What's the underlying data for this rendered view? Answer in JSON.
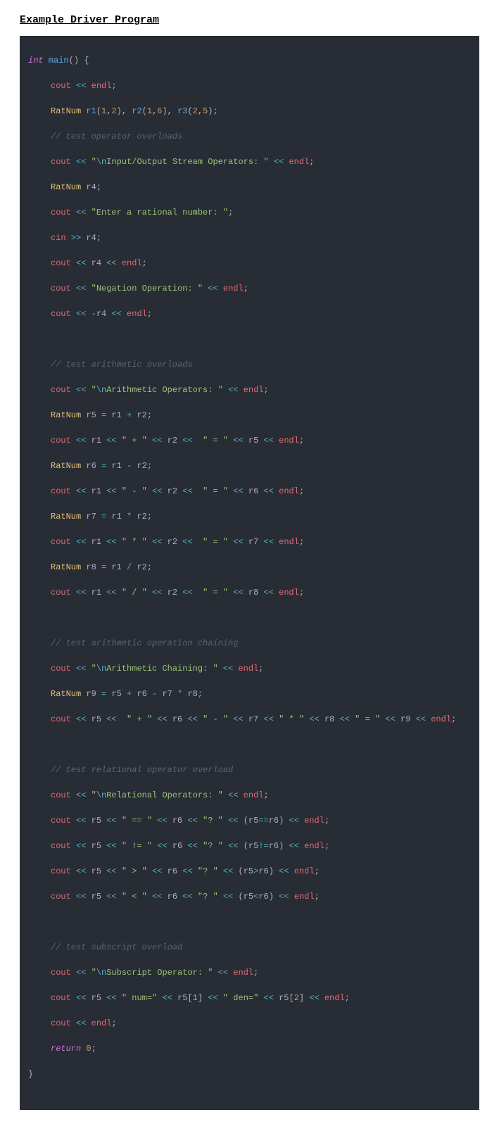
{
  "title": "Example Driver Program",
  "code": {
    "l01": {
      "kw": "int",
      "fn": " main",
      "p1": "() {"
    },
    "l02": {
      "o1": "cout ",
      "op1": "<<",
      "o2": " endl",
      "p": ";"
    },
    "l03": {
      "t": "RatNum ",
      "a": "r1",
      "p1": "(",
      "n1": "1",
      "c1": ",",
      "n2": "2",
      "p2": "), ",
      "b": "r2",
      "p3": "(",
      "n3": "1",
      "c2": ",",
      "n4": "6",
      "p4": "), ",
      "c": "r3",
      "p5": "(",
      "n5": "2",
      "c3": ",",
      "n6": "5",
      "p6": ");"
    },
    "l04": {
      "cmt": "// test operator overloads"
    },
    "l05": {
      "a": "cout ",
      "op1": "<<",
      "sp": " ",
      "s1": "\"",
      "e1": "\\n",
      "s2": "Input/Output Stream Operators: \"",
      "sp2": " ",
      "op2": "<<",
      "b": " endl",
      "p": ";"
    },
    "l06": {
      "t": "RatNum ",
      "v": "r4",
      "p": ";"
    },
    "l07": {
      "a": "cout ",
      "op": "<<",
      "s": " \"Enter a rational number: \"",
      "p": ";"
    },
    "l08": {
      "a": "cin ",
      "op": ">>",
      "b": " r4",
      "p": ";"
    },
    "l09": {
      "a": "cout ",
      "op1": "<<",
      "b": " r4 ",
      "op2": "<<",
      "c": " endl",
      "p": ";"
    },
    "l10": {
      "a": "cout ",
      "op": "<<",
      "s": " \"Negation Operation: \"",
      "sp": " ",
      "op2": "<<",
      "c": " endl",
      "p": ";"
    },
    "l11": {
      "a": "cout ",
      "op1": "<<",
      "sp": " ",
      "neg": "-",
      "b": "r4 ",
      "op2": "<<",
      "c": " endl",
      "p": ";"
    },
    "l12": {
      "cmt": "// test arithmetic overloads"
    },
    "l13": {
      "a": "cout ",
      "op1": "<<",
      "sp": " ",
      "s1": "\"",
      "e1": "\\n",
      "s2": "Arithmetic Operators: \"",
      "sp2": " ",
      "op2": "<<",
      "c": " endl",
      "p": ";"
    },
    "l14": {
      "t": "RatNum ",
      "v": "r5 ",
      "eq": "=",
      "b": " r1 ",
      "plus": "+",
      "c": " r2",
      "p": ";"
    },
    "l15": {
      "a": "cout ",
      "op1": "<<",
      "b": " r1 ",
      "op2": "<<",
      "s1": " \" + \" ",
      "op3": "<<",
      "c": " r2 ",
      "op4": "<<",
      "s2": "  \" = \" ",
      "op5": "<<",
      "d": " r5 ",
      "op6": "<<",
      "e": " endl",
      "p": ";"
    },
    "l16": {
      "t": "RatNum ",
      "v": "r6 ",
      "eq": "=",
      "b": " r1 ",
      "minus": "-",
      "c": " r2",
      "p": ";"
    },
    "l17": {
      "a": "cout ",
      "op1": "<<",
      "b": " r1 ",
      "op2": "<<",
      "s1": " \" - \" ",
      "op3": "<<",
      "c": " r2 ",
      "op4": "<<",
      "s2": "  \" = \" ",
      "op5": "<<",
      "d": " r6 ",
      "op6": "<<",
      "e": " endl",
      "p": ";"
    },
    "l18": {
      "t": "RatNum ",
      "v": "r7 ",
      "eq": "=",
      "b": " r1 ",
      "star": "*",
      "c": " r2",
      "p": ";"
    },
    "l19": {
      "a": "cout ",
      "op1": "<<",
      "b": " r1 ",
      "op2": "<<",
      "s1": " \" * \" ",
      "op3": "<<",
      "c": " r2 ",
      "op4": "<<",
      "s2": "  \" = \" ",
      "op5": "<<",
      "d": " r7 ",
      "op6": "<<",
      "e": " endl",
      "p": ";"
    },
    "l20": {
      "t": "RatNum ",
      "v": "r8 ",
      "eq": "=",
      "b": " r1 ",
      "div": "/",
      "c": " r2",
      "p": ";"
    },
    "l21": {
      "a": "cout ",
      "op1": "<<",
      "b": " r1 ",
      "op2": "<<",
      "s1": " \" / \" ",
      "op3": "<<",
      "c": " r2 ",
      "op4": "<<",
      "s2": "  \" = \" ",
      "op5": "<<",
      "d": " r8 ",
      "op6": "<<",
      "e": " endl",
      "p": ";"
    },
    "l22": {
      "cmt": "// test arithmetic operation chaining"
    },
    "l23": {
      "a": "cout ",
      "op1": "<<",
      "sp": " ",
      "s1": "\"",
      "e1": "\\n",
      "s2": "Arithmetic Chaining: \"",
      "sp2": " ",
      "op2": "<<",
      "c": " endl",
      "p": ";"
    },
    "l24": {
      "t": "RatNum ",
      "v": "r9 ",
      "eq": "=",
      "a": " r5 ",
      "plus": "+",
      "b": " r6 ",
      "minus": "-",
      "c": " r7 ",
      "star": "*",
      "d": " r8",
      "p": ";"
    },
    "l25": {
      "a": "cout ",
      "op1": "<<",
      "b": " r5 ",
      "op2": "<<",
      "s1": "  \" + \" ",
      "op3": "<<",
      "c": " r6 ",
      "op4": "<<",
      "s2": " \" - \" ",
      "op5": "<<",
      "d": " r7 ",
      "op6": "<<",
      "s3": " \" * \" ",
      "op7": "<<",
      "e": " r8 ",
      "op8": "<<",
      "s4": " \" = \" ",
      "op9": "<<",
      "f": " r9 ",
      "op10": "<<",
      "g": " endl",
      "p": ";"
    },
    "l26": {
      "cmt": "// test relational operator overload"
    },
    "l27": {
      "a": "cout ",
      "op1": "<<",
      "sp": " ",
      "s1": "\"",
      "e1": "\\n",
      "s2": "Relational Operators: \"",
      "sp2": " ",
      "op2": "<<",
      "c": " endl",
      "p": ";"
    },
    "l28": {
      "a": "cout ",
      "op1": "<<",
      "b": " r5 ",
      "op2": "<<",
      "s1": " \" == \" ",
      "op3": "<<",
      "c": " r6 ",
      "op4": "<<",
      "s2": " \"? \" ",
      "op5": "<<",
      "p1": " (",
      "d": "r5",
      "cmp": "==",
      "e": "r6",
      "p2": ") ",
      "op6": "<<",
      "f": " endl",
      "p3": ";"
    },
    "l29": {
      "a": "cout ",
      "op1": "<<",
      "b": " r5 ",
      "op2": "<<",
      "s1": " \" != \" ",
      "op3": "<<",
      "c": " r6 ",
      "op4": "<<",
      "s2": " \"? \" ",
      "op5": "<<",
      "p1": " (",
      "d": "r5",
      "cmp": "!=",
      "e": "r6",
      "p2": ") ",
      "op6": "<<",
      "f": " endl",
      "p3": ";"
    },
    "l30": {
      "a": "cout ",
      "op1": "<<",
      "b": " r5 ",
      "op2": "<<",
      "s1": " \" > \" ",
      "op3": "<<",
      "c": " r6 ",
      "op4": "<<",
      "s2": " \"? \" ",
      "op5": "<<",
      "p1": " (",
      "d": "r5",
      "cmp": ">",
      "e": "r6",
      "p2": ") ",
      "op6": "<<",
      "f": " endl",
      "p3": ";"
    },
    "l31": {
      "a": "cout ",
      "op1": "<<",
      "b": " r5 ",
      "op2": "<<",
      "s1": " \" < \" ",
      "op3": "<<",
      "c": " r6 ",
      "op4": "<<",
      "s2": " \"? \" ",
      "op5": "<<",
      "p1": " (",
      "d": "r5",
      "cmp": "<",
      "e": "r6",
      "p2": ") ",
      "op6": "<<",
      "f": " endl",
      "p3": ";"
    },
    "l32": {
      "cmt": "// test subscript overload"
    },
    "l33": {
      "a": "cout ",
      "op1": "<<",
      "sp": " ",
      "s1": "\"",
      "e1": "\\n",
      "s2": "Subscript Operator: \"",
      "sp2": " ",
      "op2": "<<",
      "c": " endl",
      "p": ";"
    },
    "l34": {
      "a": "cout ",
      "op1": "<<",
      "b": " r5 ",
      "op2": "<<",
      "s1": " \" num=\" ",
      "op3": "<<",
      "c": " r5",
      "br1": "[",
      "n1": "1",
      "br2": "] ",
      "op4": "<<",
      "s2": " \" den=\" ",
      "op5": "<<",
      "d": " r5",
      "br3": "[",
      "n2": "2",
      "br4": "] ",
      "op6": "<<",
      "e": " endl",
      "p": ";"
    },
    "l35": {
      "a": "cout ",
      "op": "<<",
      "b": " endl",
      "p": ";"
    },
    "l36": {
      "kw": "return ",
      "n": "0",
      "p": ";"
    },
    "l37": {
      "p": "}"
    }
  }
}
